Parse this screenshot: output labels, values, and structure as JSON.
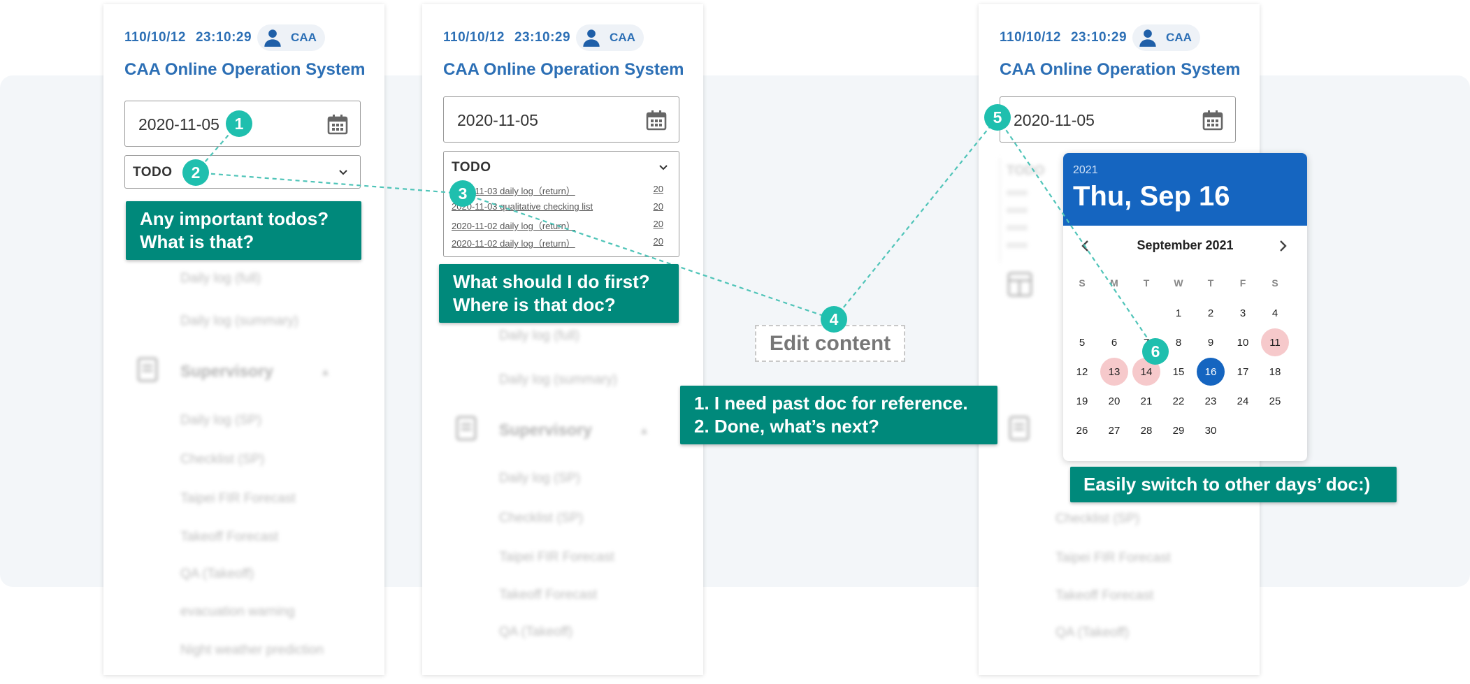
{
  "header": {
    "date": "110/10/12",
    "time": "23:10:29",
    "user": "CAA",
    "system_title": "CAA Online Operation System"
  },
  "date_field": {
    "value": "2020-11-05"
  },
  "todo": {
    "label": "TODO",
    "items": [
      {
        "text": "2020-11-03 daily log（return）",
        "count": "20"
      },
      {
        "text": "2020-11-03 qualitative checking list",
        "count": "20"
      },
      {
        "text": "2020-11-02 daily log（return）",
        "count": "20"
      },
      {
        "text": "2020-11-02 daily log（return）",
        "count": "20"
      }
    ]
  },
  "menu": {
    "daily_log_full": "Daily log (full)",
    "daily_log_summary": "Daily log (summary)",
    "supervisory": "Supervisory",
    "daily_log_sp": "Daily log (SP)",
    "checklist_sp": "Checklist (SP)",
    "taipei_fir": "Taipei FIR Forecast",
    "takeoff_forecast": "Takeoff Forecast",
    "qa_takeoff": "QA (Takeoff)",
    "evacuation_warning": "evacuation warning",
    "night_weather": "Night weather prediction"
  },
  "calendar": {
    "year": "2021",
    "selected_label": "Thu, Sep 16",
    "month_label": "September 2021",
    "weekdays": [
      "S",
      "M",
      "T",
      "W",
      "T",
      "F",
      "S"
    ],
    "first_weekday": 3,
    "days": 30,
    "selected_day": 16,
    "highlighted_days": [
      11,
      13,
      14
    ]
  },
  "annotations": {
    "b1": "1",
    "b2": "2",
    "b3": "3",
    "b4": "4",
    "b5": "5",
    "b6": "6",
    "callout1_line1": "Any important todos?",
    "callout1_line2": "What is that?",
    "callout2_line1": "What should I do first?",
    "callout2_line2": "Where is that doc?",
    "edit_content": "Edit content",
    "callout3_line1": "1. I need past doc for reference.",
    "callout3_line2": "2. Done, what’s next?",
    "callout4": "Easily switch to other days’ doc:)"
  },
  "colors": {
    "brand_blue": "#2c6fb5",
    "callout_teal": "#00897b",
    "badge_teal": "#1fbfae",
    "calendar_header": "#1565c0",
    "highlight_pink": "#f6c9cb"
  }
}
